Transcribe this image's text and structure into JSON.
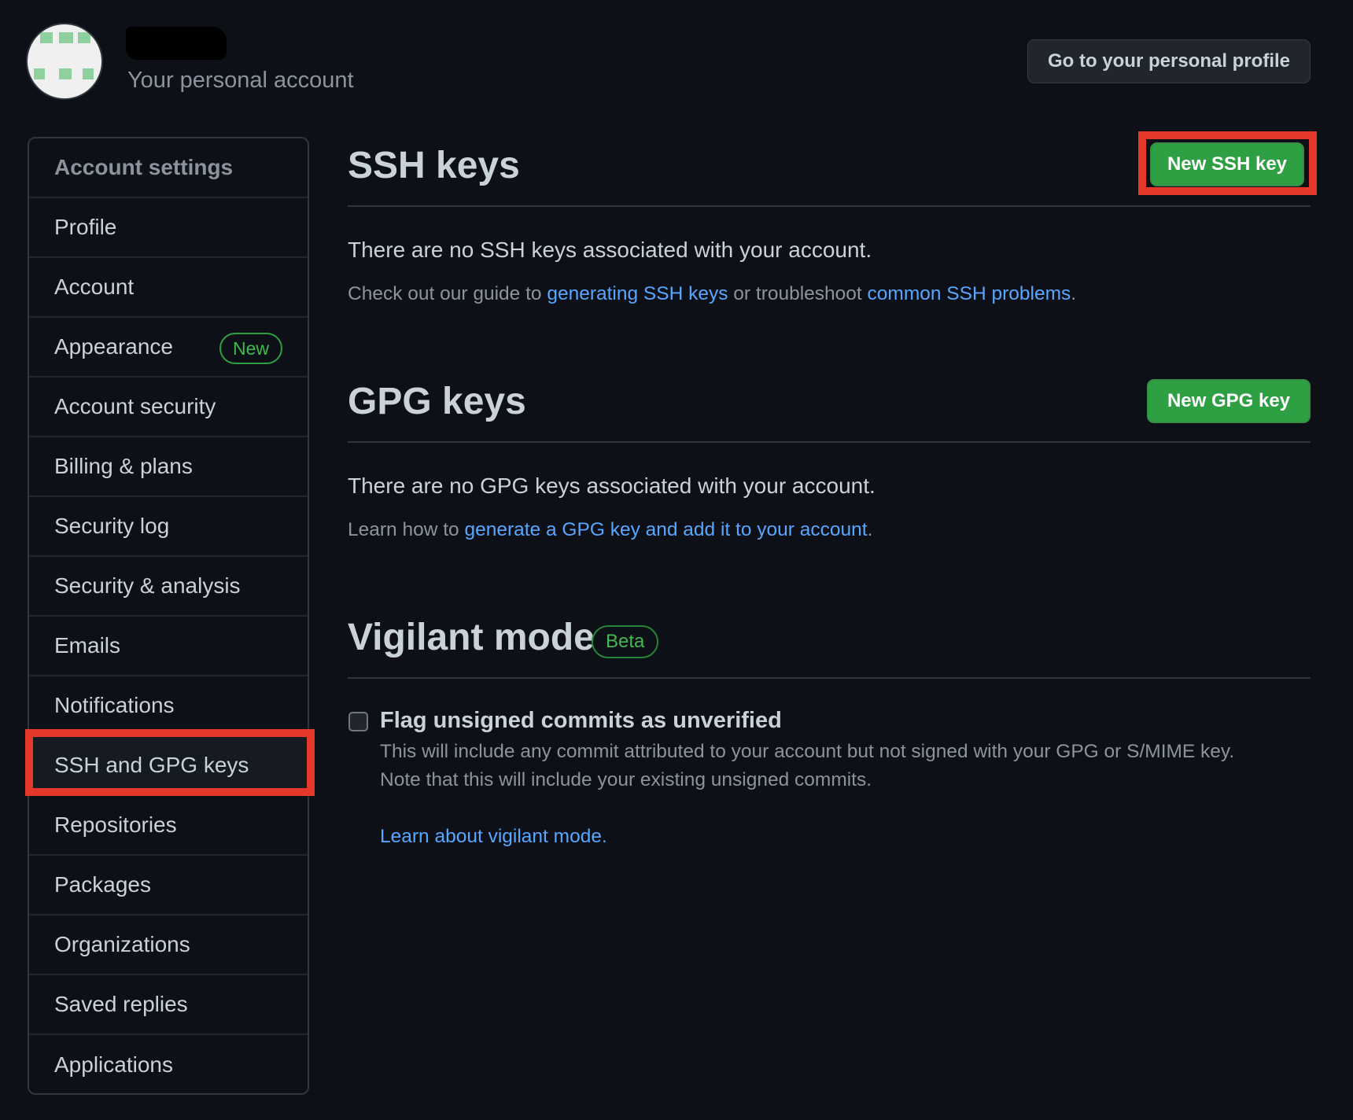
{
  "header": {
    "subtitle": "Your personal account",
    "profile_button": "Go to your personal profile"
  },
  "sidebar": {
    "heading": "Account settings",
    "items": [
      {
        "label": "Profile"
      },
      {
        "label": "Account"
      },
      {
        "label": "Appearance",
        "badge": "New"
      },
      {
        "label": "Account security"
      },
      {
        "label": "Billing & plans"
      },
      {
        "label": "Security log"
      },
      {
        "label": "Security & analysis"
      },
      {
        "label": "Emails"
      },
      {
        "label": "Notifications"
      },
      {
        "label": "SSH and GPG keys",
        "active": true
      },
      {
        "label": "Repositories"
      },
      {
        "label": "Packages"
      },
      {
        "label": "Organizations"
      },
      {
        "label": "Saved replies"
      },
      {
        "label": "Applications"
      }
    ]
  },
  "ssh": {
    "title": "SSH keys",
    "new_button": "New SSH key",
    "empty_text": "There are no SSH keys associated with your account.",
    "guide_prefix": "Check out our guide to ",
    "guide_link": "generating SSH keys",
    "guide_middle": " or troubleshoot ",
    "problems_link": "common SSH problems",
    "guide_suffix": "."
  },
  "gpg": {
    "title": "GPG keys",
    "new_button": "New GPG key",
    "empty_text": "There are no GPG keys associated with your account.",
    "learn_prefix": "Learn how to ",
    "learn_link": "generate a GPG key and add it to your account",
    "learn_suffix": "."
  },
  "vigilant": {
    "title": "Vigilant mode",
    "badge": "Beta",
    "checkbox_label": "Flag unsigned commits as unverified",
    "checkbox_checked": false,
    "note_line1": "This will include any commit attributed to your account but not signed with your GPG or S/MIME key.",
    "note_line2": "Note that this will include your existing unsigned commits.",
    "learn_link": "Learn about vigilant mode",
    "learn_suffix": "."
  },
  "colors": {
    "background": "#0d1117",
    "accent_green": "#2ea043",
    "link_blue": "#58a6ff",
    "highlight_red": "#e4392a"
  }
}
